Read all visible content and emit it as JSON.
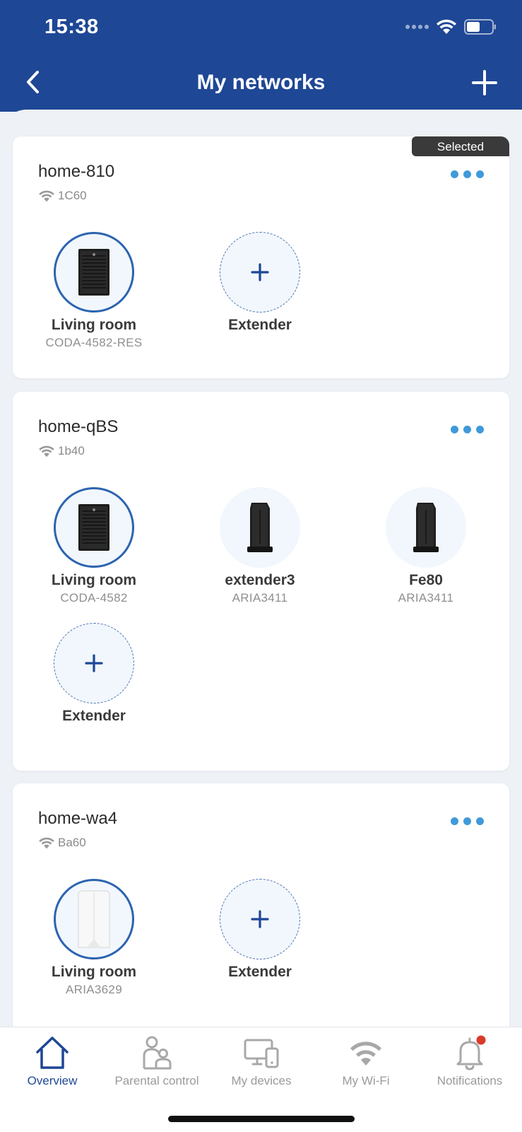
{
  "status_bar": {
    "time": "15:38"
  },
  "nav": {
    "title": "My networks"
  },
  "colors": {
    "header": "#1e4795",
    "accent": "#3f9ad9",
    "active_tab": "#1e4795",
    "notification_badge": "#d93b2b"
  },
  "networks": [
    {
      "name": "home-810",
      "wifi_id": "1C60",
      "selected_label": "Selected",
      "nodes": [
        {
          "label": "Living room",
          "model": "CODA-4582-RES",
          "kind": "main",
          "icon": "router-black-icon"
        },
        {
          "label": "Extender",
          "kind": "add",
          "icon": "plus-icon"
        }
      ]
    },
    {
      "name": "home-qBS",
      "wifi_id": "1b40",
      "nodes": [
        {
          "label": "Living room",
          "model": "CODA-4582",
          "kind": "main",
          "icon": "router-black-icon"
        },
        {
          "label": "extender3",
          "model": "ARIA3411",
          "kind": "extender",
          "icon": "extender-black-icon"
        },
        {
          "label": "Fe80",
          "model": "ARIA3411",
          "kind": "extender",
          "icon": "extender-black-icon"
        },
        {
          "label": "Extender",
          "kind": "add",
          "icon": "plus-icon"
        }
      ]
    },
    {
      "name": "home-wa4",
      "wifi_id": "Ba60",
      "nodes": [
        {
          "label": "Living room",
          "model": "ARIA3629",
          "kind": "main",
          "icon": "router-white-icon"
        },
        {
          "label": "Extender",
          "kind": "add",
          "icon": "plus-icon"
        }
      ]
    }
  ],
  "tabs": [
    {
      "label": "Overview",
      "icon": "home-icon",
      "active": true
    },
    {
      "label": "Parental control",
      "icon": "family-icon",
      "active": false
    },
    {
      "label": "My devices",
      "icon": "devices-icon",
      "active": false
    },
    {
      "label": "My Wi-Fi",
      "icon": "wifi-icon",
      "active": false
    },
    {
      "label": "Notifications",
      "icon": "bell-icon",
      "active": false,
      "badge": true
    }
  ]
}
